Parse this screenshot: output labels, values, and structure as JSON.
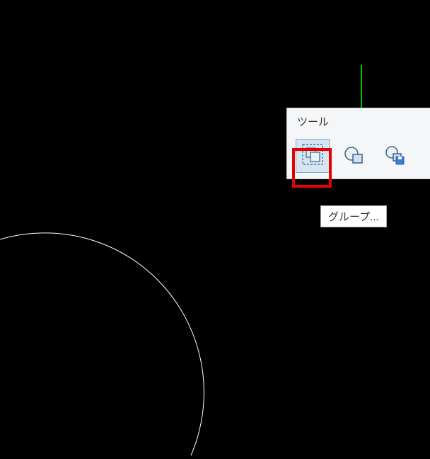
{
  "panel": {
    "title": "ツール",
    "buttons": {
      "group": {
        "name": "group-button",
        "selected": true
      },
      "circle_tool": {
        "name": "circle-tool-button",
        "selected": false
      },
      "save_tool": {
        "name": "save-shape-button",
        "selected": false
      }
    }
  },
  "tooltip": {
    "text": "グループ..."
  },
  "canvas": {
    "axis_color": "#00c800",
    "drawing": "circle-arc"
  },
  "highlight": {
    "target": "group-button",
    "color": "#e60000"
  }
}
